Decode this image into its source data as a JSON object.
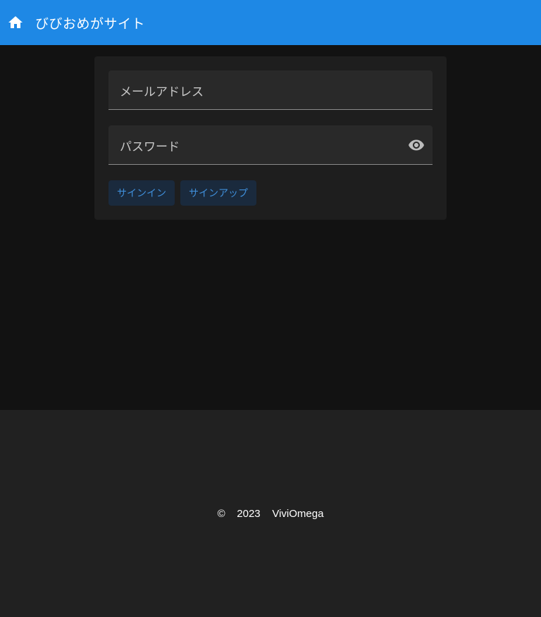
{
  "app_bar": {
    "home_icon": "home-icon",
    "title": "びびおめがサイト",
    "color": "#1e88e5"
  },
  "login_form": {
    "email_label": "メールアドレス",
    "password_label": "パスワード",
    "visibility_icon": "eye-icon",
    "signin_label": "サインイン",
    "signup_label": "サインアップ"
  },
  "footer": {
    "text": "©    2023    ViviOmega"
  }
}
